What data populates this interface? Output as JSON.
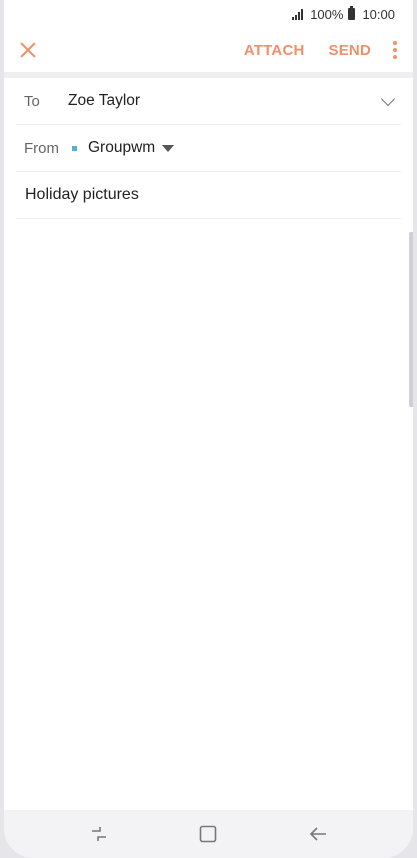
{
  "status": {
    "battery_text": "100%",
    "time": "10:00"
  },
  "toolbar": {
    "attach_label": "ATTACH",
    "send_label": "SEND"
  },
  "compose": {
    "to_label": "To",
    "to_value": "Zoe Taylor",
    "from_label": "From",
    "from_value": "Groupwm",
    "subject": "Holiday pictures",
    "body": ""
  },
  "colors": {
    "accent": "#f0906a",
    "account_dot": "#4fb3cf"
  }
}
